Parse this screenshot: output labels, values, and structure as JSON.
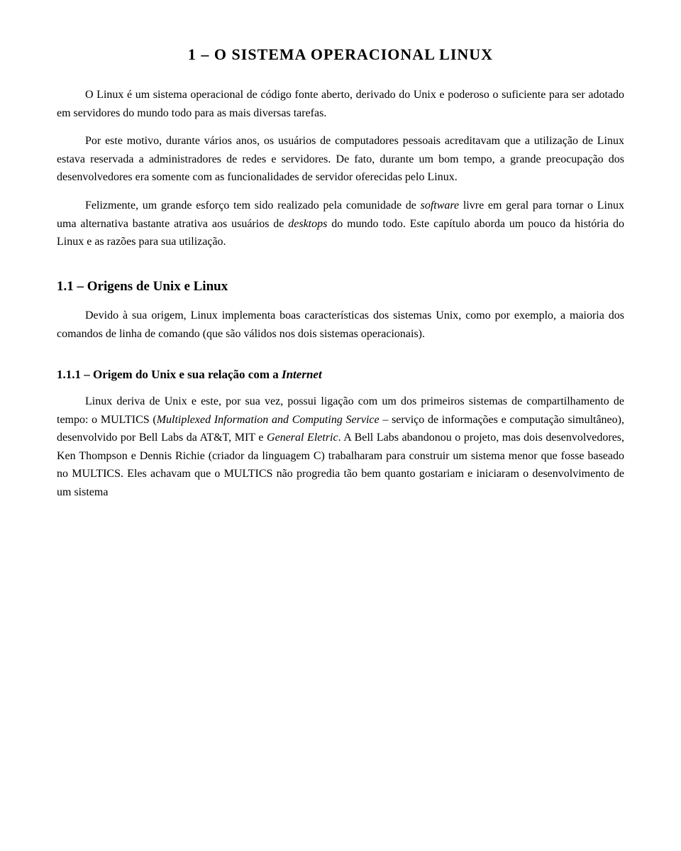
{
  "page": {
    "chapter_title": "1 – O SISTEMA OPERACIONAL LINUX",
    "intro_paragraphs": [
      "O Linux é um sistema operacional de código fonte aberto, derivado do Unix e poderoso o suficiente para ser adotado em servidores do mundo todo para as mais diversas tarefas.",
      "Por este motivo, durante vários anos, os usuários de computadores pessoais acreditavam que a utilização de Linux estava reservada a administradores de redes e servidores. De fato, durante um bom tempo, a grande preocupação dos desenvolvedores era somente com as funcionalidades de servidor oferecidas pelo Linux.",
      "Felizmente, um grande esforço tem sido realizado pela comunidade de software livre em geral para tornar o Linux uma alternativa bastante atrativa aos usuários de desktops do mundo todo. Este capítulo aborda um pouco da história do Linux e as razões para sua utilização."
    ],
    "section1": {
      "title": "1.1 – Origens de Unix e Linux",
      "paragraphs": [
        "Devido à sua origem, Linux implementa boas características dos sistemas Unix, como por exemplo, a maioria dos comandos de linha de comando (que são válidos nos dois sistemas operacionais)."
      ]
    },
    "section1_1": {
      "title": "1.1.1 – Origem do Unix e sua relação com a Internet",
      "paragraphs": [
        "Linux deriva de Unix e este, por sua vez, possui ligação com um dos primeiros sistemas de compartilhamento de tempo: o MULTICS (Multiplexed Information and Computing Service – serviço de informações e computação simultâneo), desenvolvido por Bell Labs da AT&T, MIT e General Eletric. A Bell Labs abandonou o projeto, mas dois desenvolvedores, Ken Thompson e Dennis Richie (criador da linguagem C) trabalharam para construir um sistema menor que fosse baseado no MULTICS. Eles achavam que o MULTICS não progredia tão bem quanto gostariam e iniciaram o desenvolvimento de um sistema"
      ]
    }
  }
}
